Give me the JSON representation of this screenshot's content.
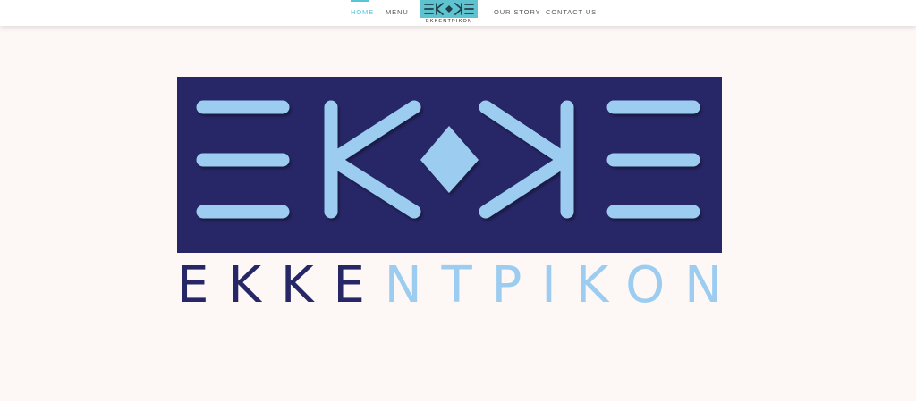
{
  "colors": {
    "accent": "#57c4d8",
    "logo_navy": "#272768",
    "logo_light_blue": "#9ccdf0",
    "nav_logo_bg": "#5fc3cf",
    "nav_logo_ink": "#1f3f48",
    "background": "#fdf8f6"
  },
  "nav": {
    "links": [
      {
        "label": "HOME",
        "active": true
      },
      {
        "label": "MENU",
        "active": false
      },
      {
        "label": "OUR STORY",
        "active": false
      },
      {
        "label": "CONTACT US",
        "active": false
      }
    ],
    "logo": {
      "wordmark": "EKKENTPIKON",
      "icon": "ekkentrikon-logo-icon"
    }
  },
  "hero": {
    "logo": {
      "wordmark_dark": "EKKE",
      "wordmark_light": "NTPIKON",
      "icon": "ekkentrikon-logo-mark"
    }
  }
}
